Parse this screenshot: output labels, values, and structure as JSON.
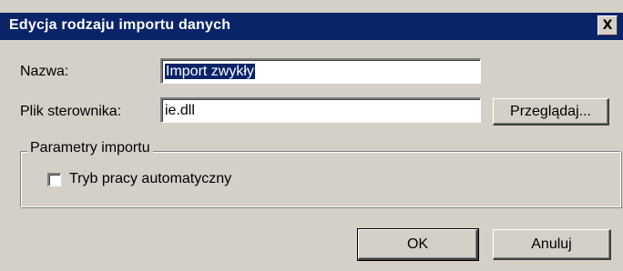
{
  "dialog": {
    "title": "Edycja rodzaju importu danych",
    "close_label": "X"
  },
  "form": {
    "name_label": "Nazwa:",
    "name_value": "Import zwykły",
    "driver_label": "Plik sterownika:",
    "driver_value": "ie.dll",
    "browse_label": "Przeglądaj..."
  },
  "group": {
    "legend": "Parametry importu",
    "auto_mode_label": "Tryb pracy automatyczny",
    "auto_mode_checked": false
  },
  "footer": {
    "ok_label": "OK",
    "cancel_label": "Anuluj"
  }
}
